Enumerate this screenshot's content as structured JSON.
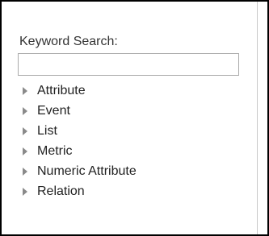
{
  "search": {
    "label": "Keyword Search:",
    "value": "",
    "placeholder": ""
  },
  "tree": {
    "items": [
      {
        "label": "Attribute"
      },
      {
        "label": "Event"
      },
      {
        "label": "List"
      },
      {
        "label": "Metric"
      },
      {
        "label": "Numeric Attribute"
      },
      {
        "label": "Relation"
      }
    ]
  },
  "icons": {
    "collapsed": "triangle-right-icon"
  },
  "colors": {
    "frame_border": "#000000",
    "text": "#222222",
    "caret": "#8a8a8a",
    "input_border": "#a9a9a9"
  }
}
